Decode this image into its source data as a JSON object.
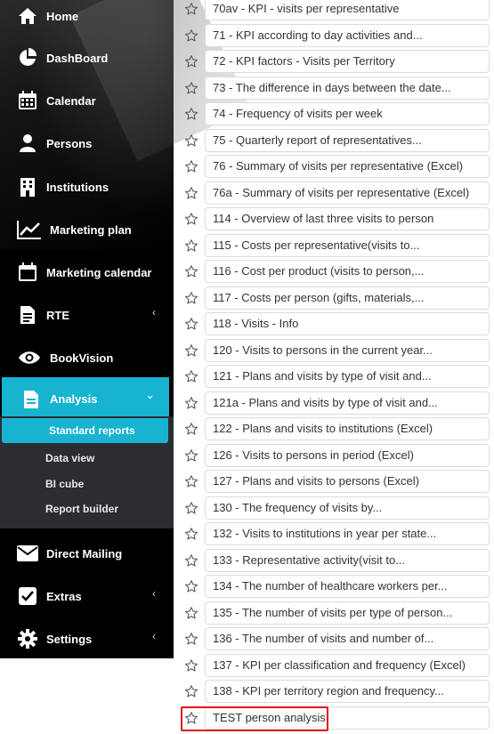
{
  "sidebar": {
    "items": [
      {
        "label": "Home",
        "icon": "home-icon"
      },
      {
        "label": "DashBoard",
        "icon": "pie-chart-icon"
      },
      {
        "label": "Calendar",
        "icon": "calendar-grid-icon"
      },
      {
        "label": "Persons",
        "icon": "persons-icon"
      },
      {
        "label": "Institutions",
        "icon": "building-icon"
      },
      {
        "label": "Marketing plan",
        "icon": "line-chart-icon"
      },
      {
        "label": "Marketing calendar",
        "icon": "calendar-icon"
      },
      {
        "label": "RTE",
        "icon": "file-icon"
      },
      {
        "label": "BookVision",
        "icon": "eye-icon"
      },
      {
        "label": "Analysis",
        "icon": "document-icon"
      },
      {
        "label": "Direct Mailing",
        "icon": "envelope-icon"
      },
      {
        "label": "Extras",
        "icon": "checkbox-icon"
      },
      {
        "label": "Settings",
        "icon": "gear-icon"
      }
    ],
    "analysis_submenu": [
      "Standard reports",
      "Data view",
      "BI cube",
      "Report builder"
    ],
    "accent_color": "#17b3d1"
  },
  "reports": [
    "70av - KPI - visits per representative",
    "71 - KPI according to day activities and...",
    "72 - KPI factors - Visits per Territory",
    "73 - The difference in days between the date...",
    "74 - Frequency of visits per week",
    "75 - Quarterly report of representatives...",
    "76 - Summary of visits per representative (Excel)",
    "76a - Summary of visits per representative (Excel)",
    "114 - Overview of last three visits to person",
    "115 - Costs per representative(visits to...",
    "116 - Cost per product (visits to person,...",
    "117 - Costs per person (gifts, materials,...",
    "118 - Visits - Info",
    "120 - Visits to persons in the current year...",
    "121 - Plans and visits by type of visit and...",
    "121a - Plans and visits by type of visit and...",
    "122 - Plans and visits to institutions (Excel)",
    "126 - Visits to persons in period (Excel)",
    "127 - Plans and visits to persons (Excel)",
    "130 - The frequency of visits by...",
    "132 - Visits to institutions in year per state...",
    "133 - Representative activity(visit to...",
    "134 - The number of healthcare workers per...",
    "135 - The number of visits per type of person...",
    "136 - The number of visits and number of...",
    "137 - KPI per classification and frequency (Excel)",
    "138 - KPI per territory region and frequency...",
    "TEST person analysis"
  ],
  "highlight_color": "#e0141e"
}
